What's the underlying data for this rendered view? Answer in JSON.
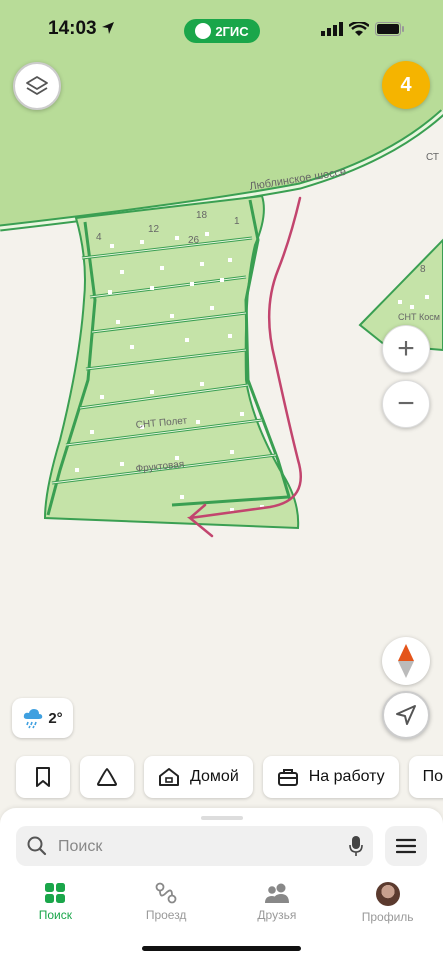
{
  "status_bar": {
    "time": "14:03",
    "brand_name": "2ГИС"
  },
  "map": {
    "road_name": "Люблинское шоссе",
    "settlement_name": "СНТ Полет",
    "street_name": "Фруктовая",
    "neighbor_settlement": "СНТ Косм",
    "edge_label": "СТ",
    "plot_numbers": [
      "4",
      "12",
      "18",
      "1",
      "26",
      "8"
    ]
  },
  "controls": {
    "cluster_count": "4",
    "zoom_in": "+",
    "zoom_out": "−"
  },
  "weather": {
    "temperature": "2°"
  },
  "quick_chips": [
    {
      "label": ""
    },
    {
      "label": ""
    },
    {
      "label": "Домой"
    },
    {
      "label": "На работу"
    },
    {
      "label": "По"
    }
  ],
  "search": {
    "placeholder": "Поиск"
  },
  "tabs": [
    {
      "label": "Поиск",
      "active": true
    },
    {
      "label": "Проезд",
      "active": false
    },
    {
      "label": "Друзья",
      "active": false
    },
    {
      "label": "Профиль",
      "active": false
    }
  ],
  "colors": {
    "accent": "#1aa64a",
    "park": "#c5e3a8",
    "road": "#3a9f52",
    "route_drawing": "#c2456e",
    "badge": "#f5b400"
  }
}
